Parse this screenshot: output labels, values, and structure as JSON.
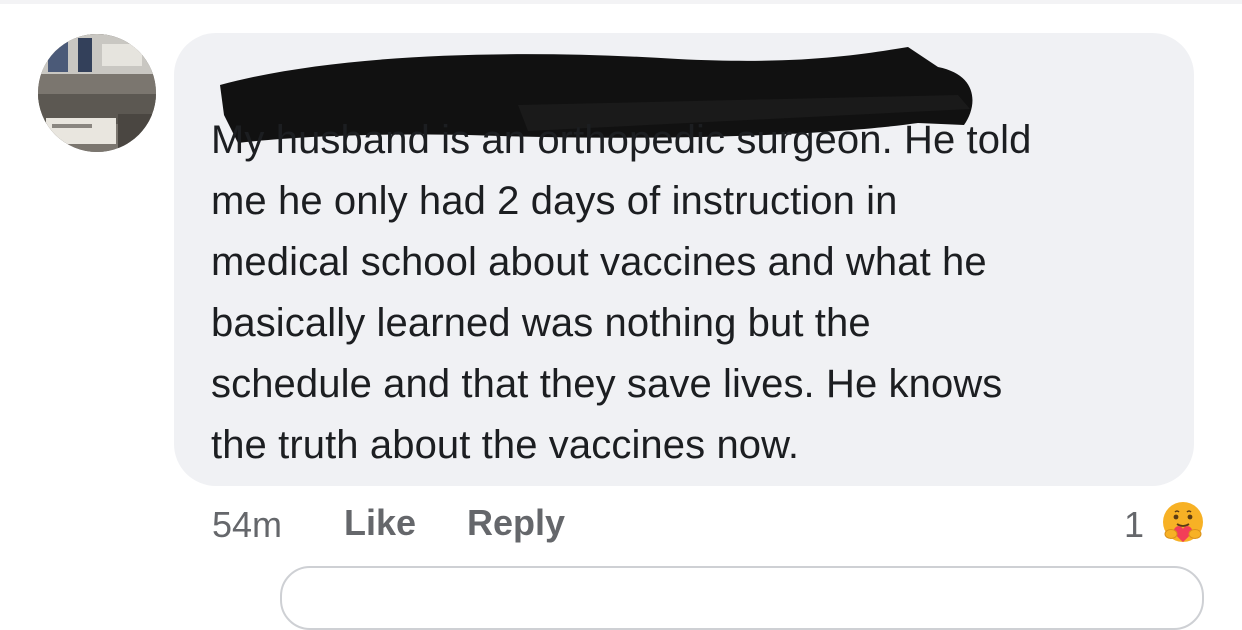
{
  "comment": {
    "lines": [
      "My husband is an orthopedic surgeon. He told",
      "me he only had 2 days of instruction in",
      "medical school about vaccines and what he",
      "basically learned was nothing but the",
      "schedule and that they save lives. He knows",
      "the truth about the vaccines now."
    ]
  },
  "meta": {
    "time": "54m",
    "like_label": "Like",
    "reply_label": "Reply",
    "reaction_count": "1",
    "reaction_icon": "care-reaction-icon"
  },
  "colors": {
    "bubble": "#f0f1f4",
    "text": "#1c1e21",
    "meta_text": "#65676b",
    "redaction": "#111111",
    "care_face": "#f7b125",
    "care_heart": "#f33e58"
  }
}
